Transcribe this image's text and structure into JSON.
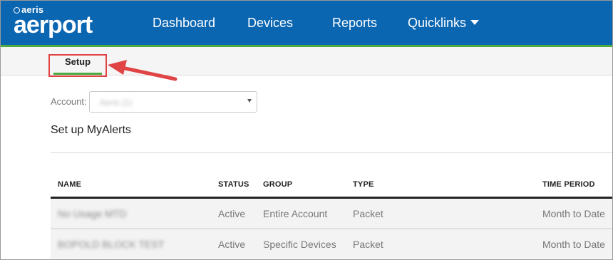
{
  "app": {
    "logo_small": "aeris",
    "logo_big": "aerport"
  },
  "nav": {
    "items": [
      {
        "label": "Dashboard"
      },
      {
        "label": "Devices"
      },
      {
        "label": "Reports"
      },
      {
        "label": "Quicklinks"
      }
    ]
  },
  "subnav": {
    "tabs": [
      {
        "label": "Setup"
      }
    ]
  },
  "account": {
    "label": "Account:",
    "value": "Aeris (1)"
  },
  "page": {
    "title": "Set up MyAlerts"
  },
  "table": {
    "columns": [
      "NAME",
      "STATUS",
      "GROUP",
      "TYPE",
      "TIME PERIOD"
    ],
    "rows": [
      {
        "name": "No Usage MTD",
        "status": "Active",
        "group": "Entire Account",
        "type": "Packet",
        "time_period": "Month to Date"
      },
      {
        "name": "BOPOLD BLOCK TEST",
        "status": "Active",
        "group": "Specific Devices",
        "type": "Packet",
        "time_period": "Month to Date"
      }
    ]
  },
  "colors": {
    "nav_bg": "#0b66b2",
    "accent_green": "#4ea93f",
    "highlight_red": "#e04444"
  }
}
